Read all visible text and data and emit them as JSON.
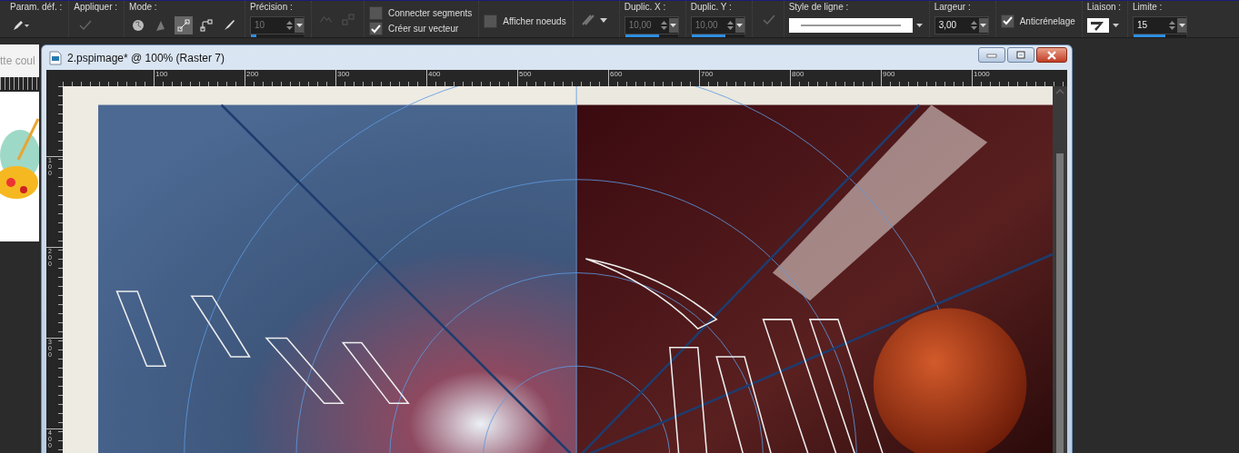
{
  "toolbar": {
    "groups": [
      {
        "kind": "pen-menu",
        "label": "Param. déf. :"
      },
      {
        "kind": "apply",
        "label": "Appliquer :",
        "disabled": true
      },
      {
        "kind": "modes",
        "label": "Mode :",
        "modes": [
          {
            "kind": "point",
            "selected": false
          },
          {
            "kind": "pen",
            "selected": false
          },
          {
            "kind": "line",
            "selected": true
          },
          {
            "kind": "corner",
            "selected": false
          },
          {
            "kind": "brush",
            "selected": false
          }
        ]
      },
      {
        "kind": "spin",
        "label": "Précision :",
        "value": "10",
        "disabled": true,
        "level": 0.1
      },
      {
        "kind": "node-tools",
        "disabled": true
      },
      {
        "kind": "checks",
        "items": [
          {
            "label": "Connecter segments",
            "checked": false
          },
          {
            "label": "Créer sur vecteur",
            "checked": true
          }
        ]
      },
      {
        "kind": "checks",
        "items": [
          {
            "label": "Afficher noeuds",
            "checked": false
          }
        ]
      },
      {
        "kind": "shape-menu"
      },
      {
        "kind": "spin",
        "label": "Duplic. X :",
        "value": "10,00",
        "disabled": true,
        "level": 0.65
      },
      {
        "kind": "spin",
        "label": "Duplic. Y :",
        "value": "10,00",
        "disabled": true,
        "level": 0.65
      },
      {
        "kind": "apply",
        "disabled": true
      },
      {
        "kind": "line-style",
        "label": "Style de ligne :"
      },
      {
        "kind": "spin",
        "label": "Largeur :",
        "value": "3,00",
        "disabled": false
      },
      {
        "kind": "checks",
        "items": [
          {
            "label": "Anticrénelage",
            "checked": true
          }
        ]
      },
      {
        "kind": "join",
        "label": "Liaison :"
      },
      {
        "kind": "spin",
        "label": "Limite :",
        "value": "15",
        "disabled": false,
        "level": 0.6
      }
    ]
  },
  "side_panel": {
    "tab_text": "tte coul"
  },
  "document": {
    "title": "2.pspimage* @ 100% (Raster 7)",
    "ruler_h": [
      "100",
      "200",
      "300",
      "400",
      "500",
      "600",
      "700",
      "800",
      "900",
      "1000"
    ],
    "ruler_v": [
      "100",
      "200",
      "300",
      "400"
    ]
  }
}
